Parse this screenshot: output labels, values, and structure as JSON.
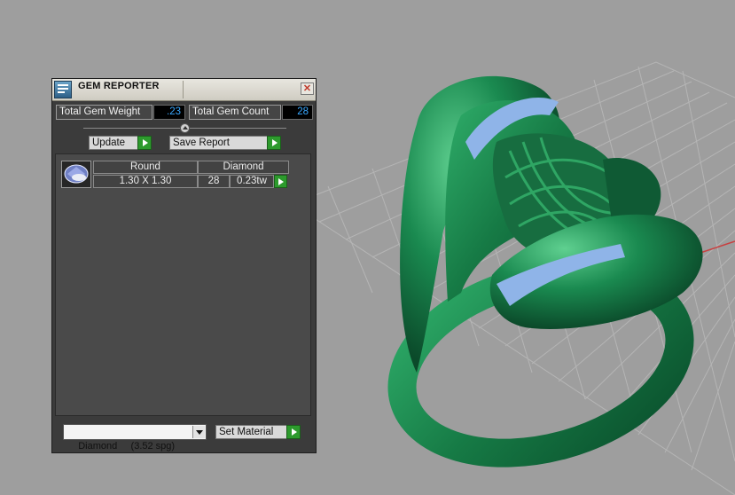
{
  "panel": {
    "title": "GEM REPORTER",
    "close_glyph": "✕",
    "total_gem_weight_label": "Total Gem Weight",
    "total_gem_weight_value": ".23",
    "total_gem_count_label": "Total Gem Count",
    "total_gem_count_value": "28",
    "update_label": "Update",
    "save_report_label": "Save Report",
    "gems": [
      {
        "shape": "Round",
        "material": "Diamond",
        "size": "1.30 X 1.30",
        "count": "28",
        "weight": "0.23tw"
      }
    ],
    "material_select_value": "Diamond     (3.52 spg)",
    "set_material_label": "Set Material"
  },
  "viewport": {
    "background": "#9e9e9e",
    "ring_color": "#1a7a4a",
    "stone_color": "#8fb4e8"
  }
}
